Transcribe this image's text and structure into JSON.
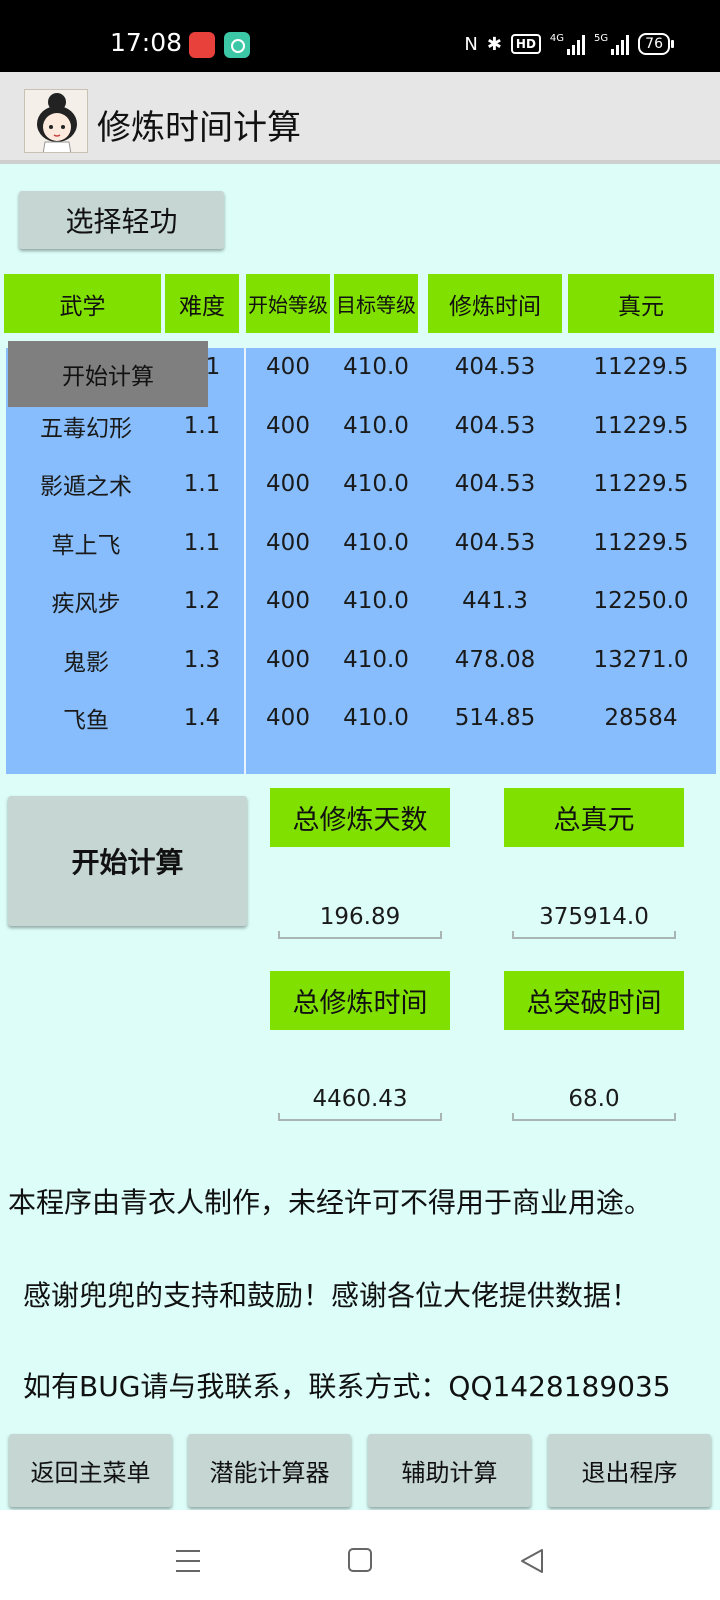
{
  "status_bar": {
    "time": "17:08",
    "nfc": "N",
    "bluetooth": "✱",
    "hd": "HD",
    "network_1": "4G",
    "network_2": "5G",
    "battery": "76"
  },
  "app": {
    "title": "修炼时间计算"
  },
  "select_button": "选择轻功",
  "table": {
    "headers": [
      "武学",
      "难度",
      "开始等级",
      "目标等级",
      "修炼时间",
      "真元"
    ],
    "rows": [
      [
        "",
        "1.1",
        "400",
        "410.0",
        "404.53",
        "11229.5"
      ],
      [
        "五毒幻形",
        "1.1",
        "400",
        "410.0",
        "404.53",
        "11229.5"
      ],
      [
        "影遁之术",
        "1.1",
        "400",
        "410.0",
        "404.53",
        "11229.5"
      ],
      [
        "草上飞",
        "1.1",
        "400",
        "410.0",
        "404.53",
        "11229.5"
      ],
      [
        "疾风步",
        "1.2",
        "400",
        "410.0",
        "441.3",
        "12250.0"
      ],
      [
        "鬼影",
        "1.3",
        "400",
        "410.0",
        "478.08",
        "13271.0"
      ],
      [
        "飞鱼",
        "1.4",
        "400",
        "410.0",
        "514.85",
        "28584"
      ]
    ],
    "overlay_label": "开始计算"
  },
  "calc_button": "开始计算",
  "totals": {
    "total_days_label": "总修炼天数",
    "total_days": "196.89",
    "total_zhenyuan_label": "总真元",
    "total_zhenyuan": "375914.0",
    "total_time_label": "总修炼时间",
    "total_time": "4460.43",
    "total_break_label": "总突破时间",
    "total_break": "68.0"
  },
  "notes": [
    "本程序由青衣人制作，未经许可不得用于商业用途。",
    "感谢兜兜的支持和鼓励！感谢各位大佬提供数据！",
    "如有BUG请与我联系，联系方式：QQ1428189035"
  ],
  "bottom_buttons": {
    "main_menu": "返回主菜单",
    "potential_calc": "潜能计算器",
    "assist_calc": "辅助计算",
    "exit": "退出程序"
  },
  "colors": {
    "header_green": "#80e000",
    "table_blue": "#87bdfc",
    "background": "#dcfdf8",
    "button_gray": "#c6d6d3"
  }
}
